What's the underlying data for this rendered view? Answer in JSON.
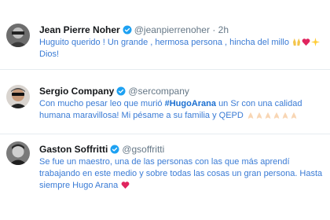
{
  "tweets": [
    {
      "name": "Jean Pierre Noher",
      "handle": "@jeanpierrenoher",
      "separator": "·",
      "time": "2h",
      "text": "Huguito querido ! Un grande , hermosa persona , hincha del millo",
      "text_end": "Dios!",
      "emojis": [
        "raised-hands-icon",
        "red-heart-icon",
        "sparkles-icon"
      ]
    },
    {
      "name": "Sergio Company",
      "handle": "@sercompany",
      "text_before": "Con mucho pesar leo que murió",
      "hashtag": "#HugoArana",
      "text_after": "un Sr con una calidad humana maravillosa! Mi pésame a su familia y QEPD",
      "emojis": [
        "folded-hands-icon",
        "folded-hands-icon",
        "folded-hands-icon",
        "folded-hands-icon",
        "folded-hands-icon",
        "folded-hands-icon"
      ]
    },
    {
      "name": "Gaston Soffritti",
      "handle": "@gsoffritti",
      "text": "Se fue un maestro, una de las personas con las que más aprendí trabajando en este medio y sobre todas las cosas un gran persona. Hasta siempre Hugo Arana",
      "emojis": [
        "red-heart-icon"
      ]
    }
  ],
  "colors": {
    "text_blue": "#3a7bd5",
    "verified_blue": "#1da1f2",
    "heart_red": "#e0245e",
    "muted": "#657786"
  }
}
